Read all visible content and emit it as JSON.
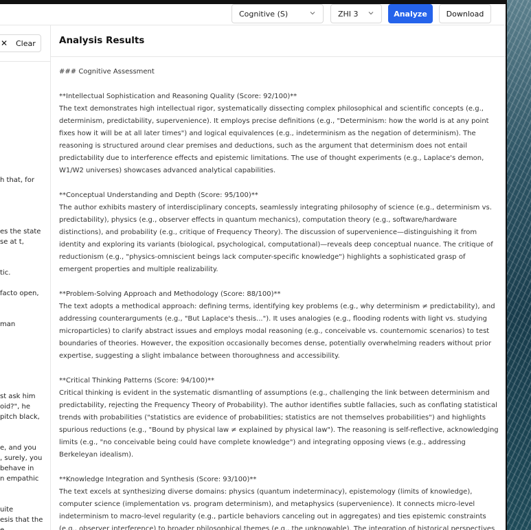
{
  "toolbar": {
    "mode_select": "Cognitive (S)",
    "zhi_select": "ZHI 3",
    "analyze_label": "Analyze",
    "download_label": "Download"
  },
  "left_panel": {
    "clear_label": "Clear",
    "clear_icon": "close-icon",
    "fragments": [
      "h that, for",
      "es the state",
      "se at t,",
      "tic.",
      "facto open,",
      "man",
      "st ask him",
      "oid?\", he",
      "pitch black,",
      "e, and you",
      ", surely, you",
      "behave in",
      "n empathic",
      "uite",
      "esis that the",
      "e"
    ]
  },
  "results": {
    "title": "Analysis Results",
    "heading": "### Cognitive Assessment",
    "sections": [
      {
        "heading": "**Intellectual Sophistication and Reasoning Quality (Score: 92/100)**",
        "lines": [
          "The text demonstrates high intellectual rigor, systematically dissecting complex philosophical and scientific concepts (e.g.,",
          "determinism, predictability, supervenience). It employs precise definitions (e.g., \"Determinism: how the world is at any point",
          "fixes how it will be at all later times\") and logical equivalences (e.g., indeterminism as the negation of determinism). The",
          "reasoning is structured around clear premises and deductions, such as the argument that determinism does not entail",
          "predictability due to interference effects and epistemic limitations. The use of thought experiments (e.g., Laplace's demon,",
          "W1/W2 universes) showcases advanced analytical capabilities."
        ]
      },
      {
        "heading": "**Conceptual Understanding and Depth (Score: 95/100)**",
        "lines": [
          "The author exhibits mastery of interdisciplinary concepts, seamlessly integrating philosophy of science (e.g., determinism vs.",
          "predictability), physics (e.g., observer effects in quantum mechanics), computation theory (e.g., software/hardware",
          "distinctions), and probability (e.g., critique of Frequency Theory). The discussion of supervenience—distinguishing it from",
          "identity and exploring its variants (biological, psychological, computational)—reveals deep conceptual nuance. The critique of",
          "reductionism (e.g., \"physics-omniscient beings lack computer-specific knowledge\") highlights a sophisticated grasp of",
          "emergent properties and multiple realizability."
        ]
      },
      {
        "heading": "**Problem-Solving Approach and Methodology (Score: 88/100)**",
        "lines": [
          "The text adopts a methodical approach: defining terms, identifying key problems (e.g., why determinism ≠ predictability), and",
          "addressing counterarguments (e.g., \"But Laplace's thesis...\"). It uses analogies (e.g., flooding rodents with light vs. studying",
          "microparticles) to clarify abstract issues and employs modal reasoning (e.g., conceivable vs. counternomic scenarios) to test",
          "boundaries of theories. However, the exposition occasionally becomes dense, potentially overwhelming readers without prior",
          "expertise, suggesting a slight imbalance between thoroughness and accessibility."
        ]
      },
      {
        "heading": "**Critical Thinking Patterns (Score: 94/100)**",
        "lines": [
          "Critical thinking is evident in the systematic dismantling of assumptions (e.g., challenging the link between determinism and",
          "predictability, rejecting the Frequency Theory of Probability). The author identifies subtle fallacies, such as conflating statistical",
          "trends with probabilities (\"statistics are evidence of probabilities; statistics are not themselves probabilities\") and highlights",
          "spurious reductions (e.g., \"Bound by physical law ≠ explained by physical law\"). The reasoning is self-reflective, acknowledging",
          "limits (e.g., \"no conceivable being could have complete knowledge\") and integrating opposing views (e.g., addressing",
          "Berkeleyan idealism)."
        ]
      },
      {
        "heading": "**Knowledge Integration and Synthesis (Score: 93/100)**",
        "lines": [
          "The text excels at synthesizing diverse domains: physics (quantum indeterminacy), epistemology (limits of knowledge),",
          "computer science (implementation vs. program determinism), and metaphysics (supervenience). It connects micro-level",
          "indeterminism to macro-level regularity (e.g., particle behaviors canceling out in aggregates) and ties epistemic constraints",
          "(e.g., observer interference) to broader philosophical themes (e.g., the unknowable). The integration of historical perspectives"
        ]
      }
    ]
  }
}
